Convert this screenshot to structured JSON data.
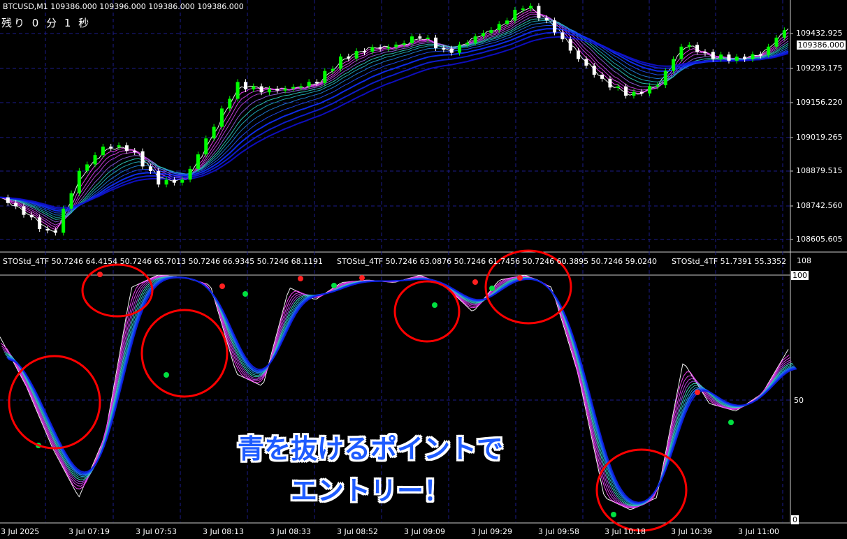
{
  "header": {
    "symbol": "BTCUSD,M1",
    "ohlc": "109386.000 109396.000 109386.000 109386.000",
    "countdown": "残り 0 分 1 秒"
  },
  "indicator": {
    "label_1": "STOStd_4TF 50.7246 64.4154 50.7246 65.7013 50.7246 66.9345 50.7246 68.1191",
    "label_2": "STOStd_4TF 50.7246 63.0876 50.7246 61.7456 50.7246 60.3895 50.7246 59.0240",
    "label_3": "STOStd_4TF 51.7391 55.3352",
    "scale_top": "108",
    "level_100": "100",
    "level_50": "50",
    "level_0": "0"
  },
  "price_axis": {
    "ticks": [
      "109432.925",
      "109293.175",
      "109156.220",
      "109019.265",
      "108879.515",
      "108742.560",
      "108605.605"
    ],
    "current_price": "109386.000"
  },
  "time_axis": {
    "labels": [
      "3 Jul 2025",
      "3 Jul 07:19",
      "3 Jul 07:53",
      "3 Jul 08:13",
      "3 Jul 08:33",
      "3 Jul 08:52",
      "3 Jul 09:09",
      "3 Jul 09:29",
      "3 Jul 09:58",
      "3 Jul 10:18",
      "3 Jul 10:39",
      "3 Jul 11:00"
    ]
  },
  "annotation": {
    "line1": "青を抜けるポイントで",
    "line2": "エントリー！"
  },
  "colors": {
    "bull": "#00ff00",
    "bear": "#ffffff",
    "grid": "#1c1c8c",
    "ribbon_fast": "#ff00ff",
    "ribbon_mid": "#00e0c0",
    "ribbon_slow": "#1020ff",
    "circle": "#ff0000"
  },
  "chart_data": [
    {
      "type": "candlestick",
      "title": "BTCUSD,M1",
      "ylim": [
        108560,
        109520
      ],
      "x": [
        "3 Jul 2025",
        "3 Jul 07:19",
        "3 Jul 07:53",
        "3 Jul 08:13",
        "3 Jul 08:33",
        "3 Jul 08:52",
        "3 Jul 09:09",
        "3 Jul 09:29",
        "3 Jul 09:58",
        "3 Jul 10:18",
        "3 Jul 10:39",
        "3 Jul 11:00"
      ],
      "close_path": [
        108760,
        108700,
        108620,
        108860,
        108960,
        108950,
        108830,
        108830,
        109010,
        109200,
        109180,
        109180,
        109200,
        109300,
        109340,
        109340,
        109380,
        109320,
        109380,
        109420,
        109500,
        109420,
        109300,
        109200,
        109150,
        109200,
        109360,
        109300,
        109290,
        109320,
        109430
      ]
    },
    {
      "type": "line",
      "title": "STOStd_4TF",
      "ylim": [
        0,
        108
      ],
      "levels": [
        100,
        50,
        0
      ],
      "series": [
        {
          "name": "STOStd_4TF",
          "values": [
            75,
            55,
            30,
            10,
            35,
            95,
            100,
            99,
            96,
            60,
            55,
            95,
            90,
            97,
            98,
            97,
            100,
            95,
            85,
            98,
            100,
            95,
            60,
            10,
            5,
            10,
            65,
            48,
            45,
            52,
            70
          ]
        }
      ]
    }
  ]
}
